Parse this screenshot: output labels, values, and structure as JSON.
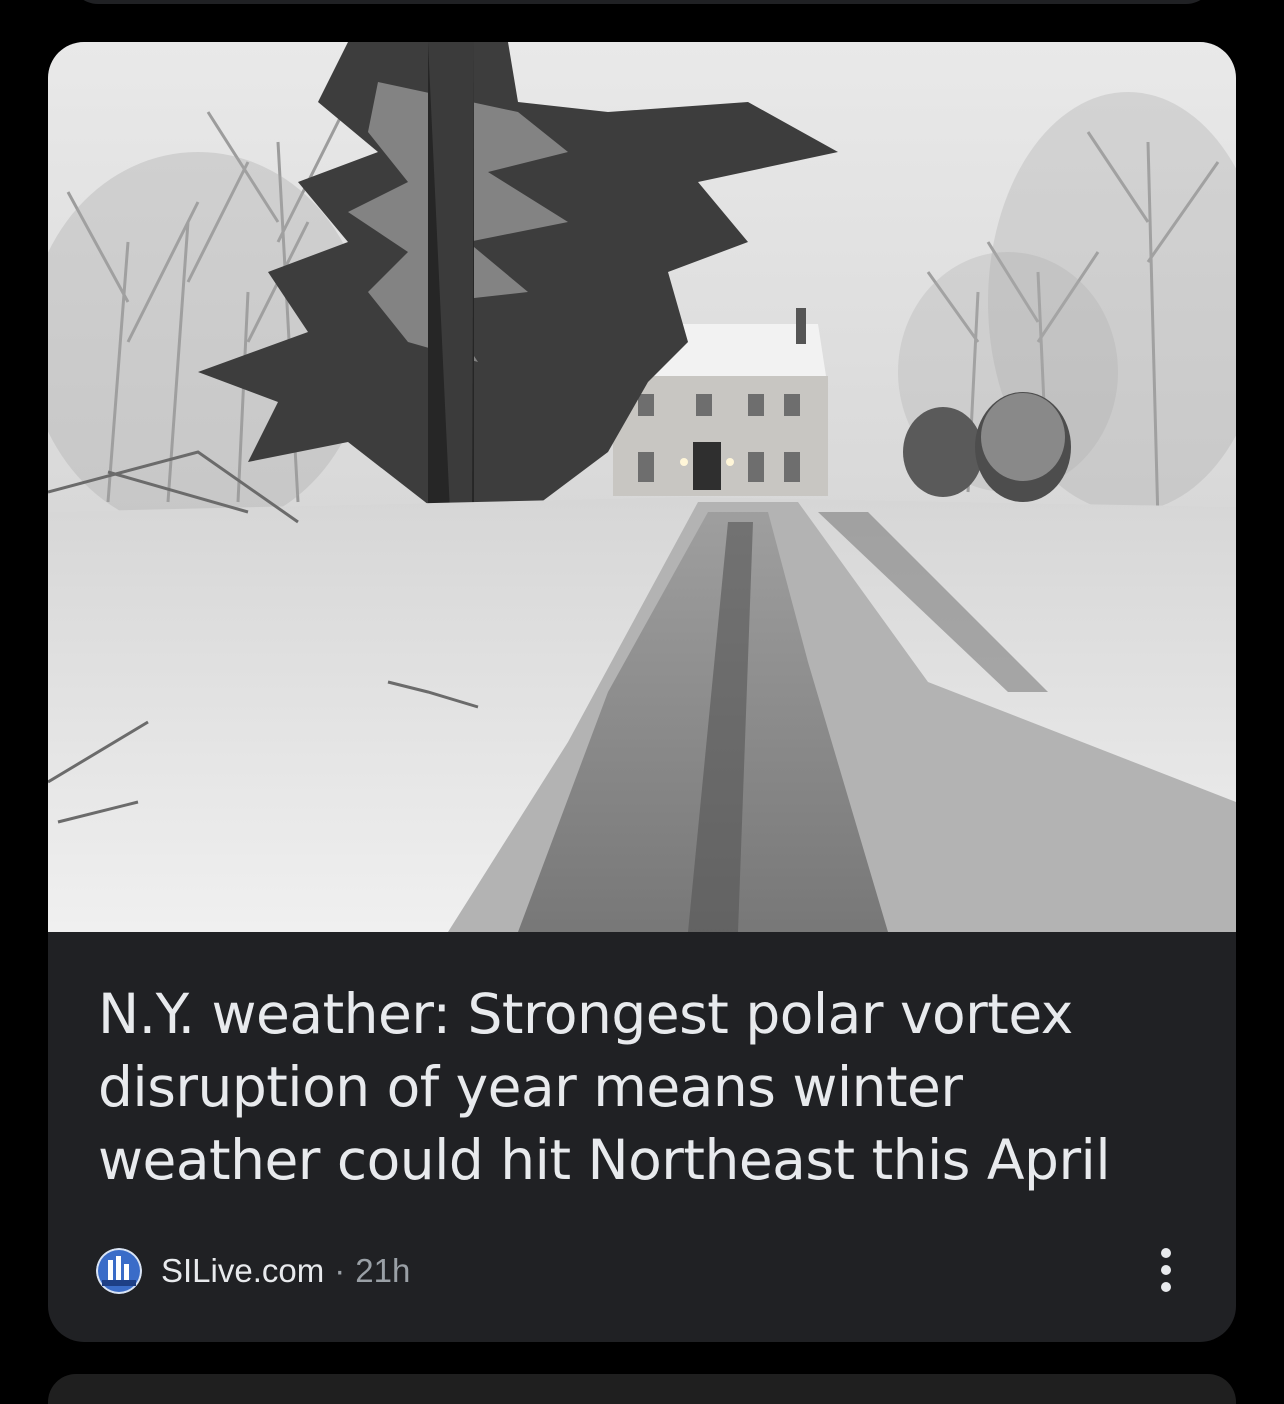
{
  "article": {
    "headline": "N.Y. weather: Strongest polar vortex disruption of year means winter weather could hit Northeast this April",
    "source": "SILive.com",
    "separator": "·",
    "age": "21h",
    "image_icon": "snowy-house-photo",
    "source_icon": "silive-logo",
    "more_icon": "more-vert-icon"
  },
  "colors": {
    "background": "#000000",
    "card": "#202124",
    "headline_text": "#e8eaed",
    "secondary_text": "#9aa0a6"
  }
}
